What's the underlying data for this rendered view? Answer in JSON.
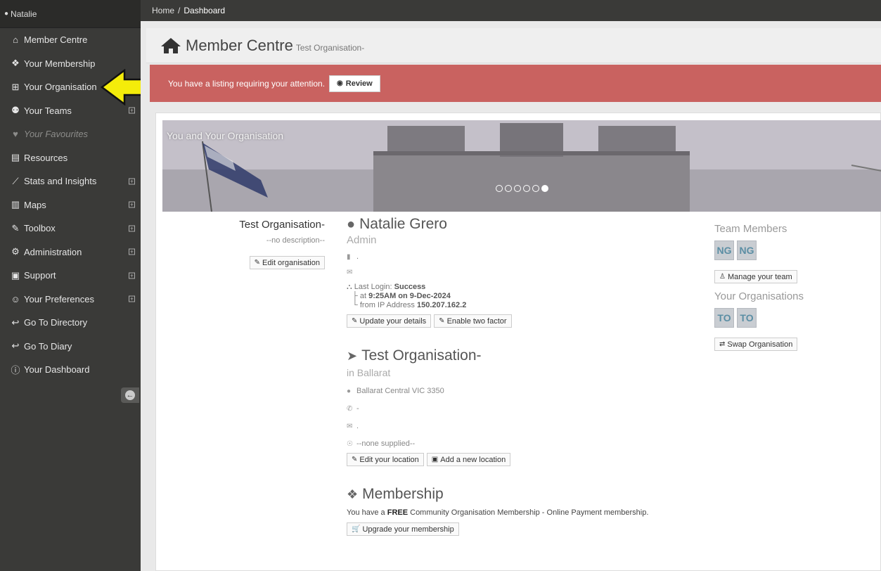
{
  "sidebar": {
    "user_name": "Natalie",
    "items": [
      {
        "label": "Member Centre",
        "icon": "home-icon",
        "glyph": "⌂",
        "expand": false,
        "dim": false
      },
      {
        "label": "Your Membership",
        "icon": "cubes-icon",
        "glyph": "❖",
        "expand": false,
        "dim": false
      },
      {
        "label": "Your Organisation",
        "icon": "grid-icon",
        "glyph": "⊞",
        "expand": false,
        "dim": false
      },
      {
        "label": "Your Teams",
        "icon": "users-icon",
        "glyph": "⚉",
        "expand": true,
        "dim": false
      },
      {
        "label": "Your Favourites",
        "icon": "heart-icon",
        "glyph": "♥",
        "expand": false,
        "dim": true
      },
      {
        "label": "Resources",
        "icon": "book-icon",
        "glyph": "▤",
        "expand": false,
        "dim": false
      },
      {
        "label": "Stats and Insights",
        "icon": "chart-line-icon",
        "glyph": "⟋",
        "expand": true,
        "dim": false
      },
      {
        "label": "Maps",
        "icon": "map-icon",
        "glyph": "▥",
        "expand": true,
        "dim": false
      },
      {
        "label": "Toolbox",
        "icon": "wrench-icon",
        "glyph": "✎",
        "expand": true,
        "dim": false
      },
      {
        "label": "Administration",
        "icon": "cogs-icon",
        "glyph": "⚙",
        "expand": true,
        "dim": false
      },
      {
        "label": "Support",
        "icon": "support-icon",
        "glyph": "▣",
        "expand": true,
        "dim": false
      },
      {
        "label": "Your Preferences",
        "icon": "user-icon",
        "glyph": "☺",
        "expand": true,
        "dim": false
      },
      {
        "label": "Go To Directory",
        "icon": "reply-icon",
        "glyph": "↩",
        "expand": false,
        "dim": false
      },
      {
        "label": "Go To Diary",
        "icon": "reply-icon",
        "glyph": "↩",
        "expand": false,
        "dim": false
      },
      {
        "label": "Your Dashboard",
        "icon": "info-circle-icon",
        "glyph": "ⓘ",
        "expand": false,
        "dim": false
      }
    ],
    "collapse_glyph": "←"
  },
  "breadcrumb": {
    "home": "Home",
    "separator": "/",
    "current": "Dashboard"
  },
  "header": {
    "title": "Member Centre",
    "subtitle": "Test Organisation-"
  },
  "alert": {
    "message": "You have a listing requiring your attention.",
    "button": "Review"
  },
  "banner": {
    "title": "You and Your Organisation",
    "slides": 6,
    "active_slide": 6
  },
  "organisation": {
    "name": "Test Organisation-",
    "description": "--no description--",
    "edit_button": "Edit organisation"
  },
  "person": {
    "name": "Natalie Grero",
    "role": "Admin",
    "phone": ".",
    "email": "",
    "login_label": "Last Login:",
    "login_status": "Success",
    "login_at_prefix": "at",
    "login_time": "9:25AM on 9-Dec-2024",
    "login_ip_prefix": "from IP Address",
    "login_ip": "150.207.162.2",
    "update_button": "Update your details",
    "twofactor_button": "Enable two factor"
  },
  "location": {
    "name": "Test Organisation-",
    "area": "in Ballarat",
    "address": "Ballarat Central VIC 3350",
    "phone": "-",
    "email": ".",
    "website": "--none supplied--",
    "edit_button": "Edit your location",
    "add_button": "Add a new location"
  },
  "membership": {
    "title": "Membership",
    "text_before": "You have a",
    "tier": "FREE",
    "text_after": "Community Organisation Membership - Online Payment membership.",
    "upgrade_button": "Upgrade your membership"
  },
  "team": {
    "heading": "Team Members",
    "members": [
      "NG",
      "NG"
    ],
    "manage_button": "Manage your team"
  },
  "organisations": {
    "heading": "Your Organisations",
    "items": [
      "TO",
      "TO"
    ],
    "swap_button": "Swap Organisation"
  },
  "colors": {
    "sidebar_bg": "#3a3a38",
    "alert_bg": "#c96260",
    "arrow_fill": "#f4ec0a",
    "badge_text": "#5b8ea4"
  }
}
